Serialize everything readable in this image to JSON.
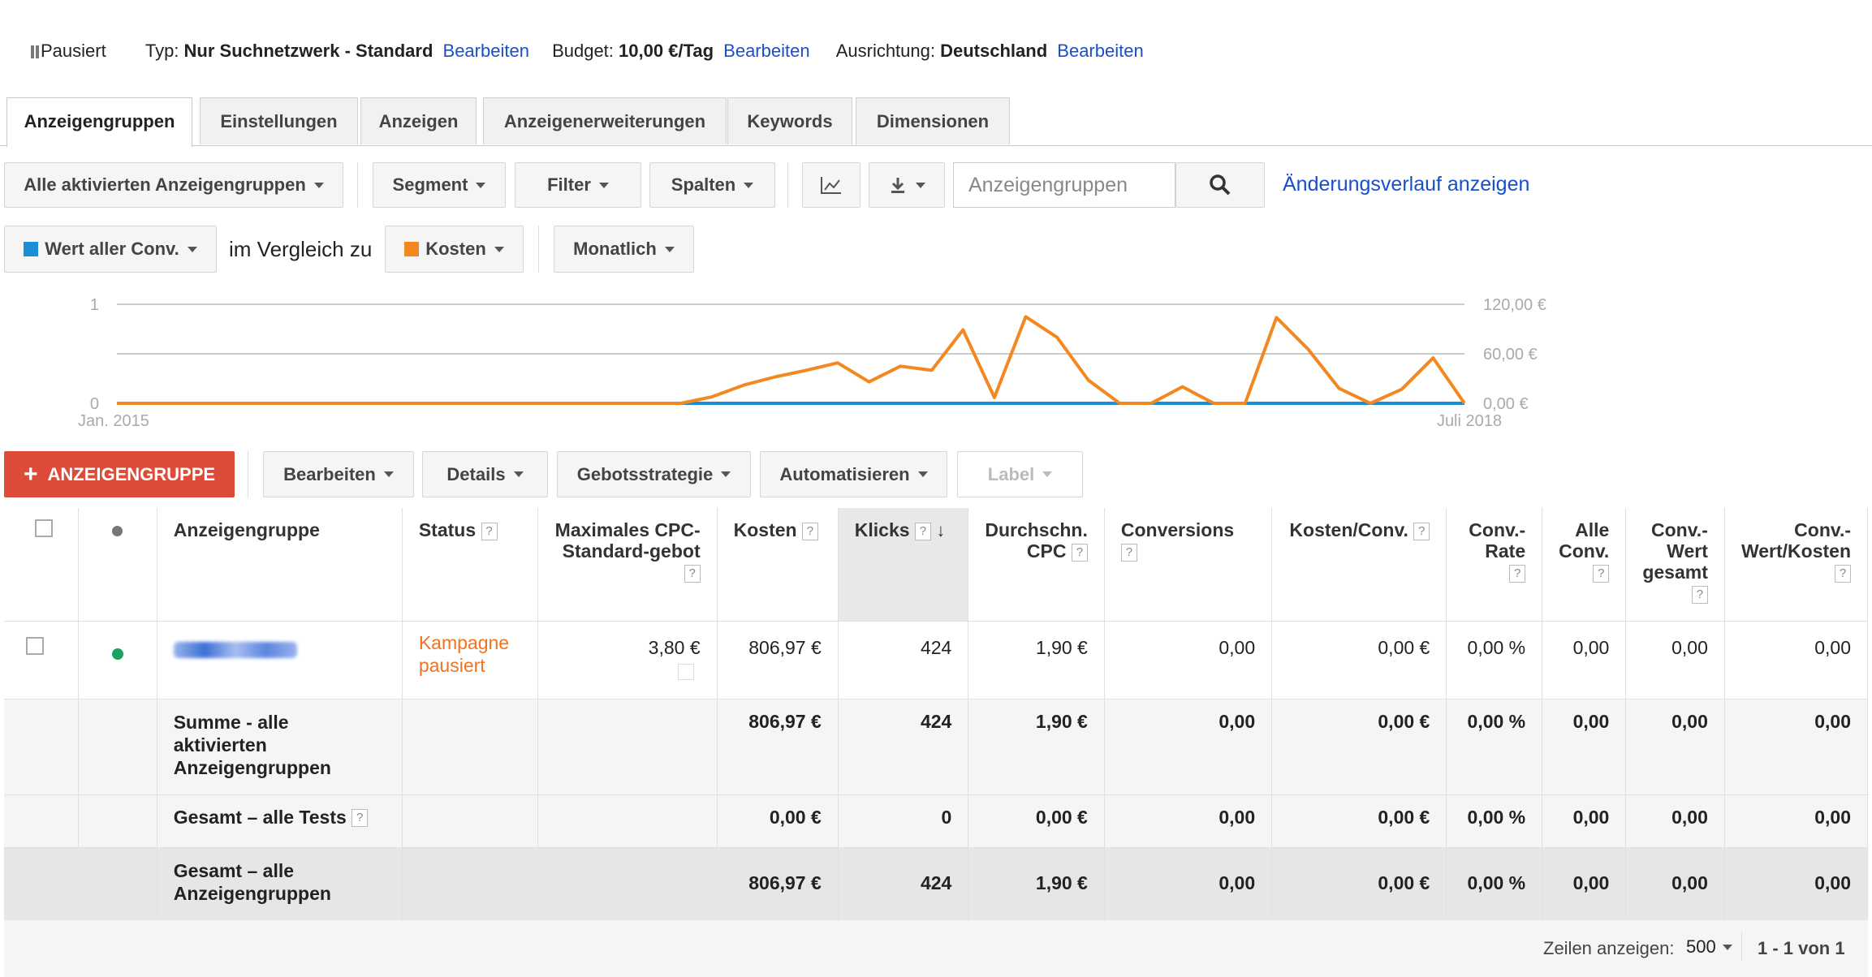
{
  "status": {
    "state": "Pausiert",
    "type_label": "Typ:",
    "type_value": "Nur Suchnetzwerk - Standard",
    "edit1": "Bearbeiten",
    "budget_label": "Budget:",
    "budget_value": "10,00 €/Tag",
    "edit2": "Bearbeiten",
    "targeting_label": "Ausrichtung:",
    "targeting_value": "Deutschland",
    "edit3": "Bearbeiten"
  },
  "tabs": [
    "Anzeigengruppen",
    "Einstellungen",
    "Anzeigen",
    "Anzeigenerweiterungen",
    "Keywords",
    "Dimensionen"
  ],
  "toolbar": {
    "filter_all": "Alle aktivierten Anzeigengruppen",
    "segment": "Segment",
    "filter": "Filter",
    "columns": "Spalten",
    "search_placeholder": "Anzeigengruppen",
    "history_link": "Änderungsverlauf anzeigen"
  },
  "chart_controls": {
    "metric1": "Wert aller Conv.",
    "compare_text": "im Vergleich zu",
    "metric2": "Kosten",
    "period": "Monatlich"
  },
  "colors": {
    "blue_series": "#1a8fd8",
    "orange_series": "#f2881f",
    "red_button": "#dd4b39",
    "link": "#1a4fc7",
    "status_orange": "#f2731f",
    "active_dot": "#1aa260"
  },
  "chart_data": {
    "type": "line",
    "x_start_label": "Jan. 2015",
    "x_end_label": "Juli 2018",
    "left_axis_ticks": [
      "0",
      "1"
    ],
    "right_axis_ticks": [
      "0,00 €",
      "60,00 €",
      "120,00 €"
    ],
    "left_ylim": [
      0,
      1
    ],
    "right_ylim": [
      0,
      120
    ],
    "grid": true,
    "series": [
      {
        "name": "Wert aller Conv.",
        "axis": "left",
        "values": [
          0,
          0,
          0,
          0,
          0,
          0,
          0,
          0,
          0,
          0,
          0,
          0,
          0,
          0,
          0,
          0,
          0,
          0,
          0,
          0,
          0,
          0,
          0,
          0,
          0,
          0,
          0,
          0,
          0,
          0,
          0,
          0,
          0,
          0,
          0,
          0,
          0,
          0,
          0,
          0,
          0,
          0,
          0
        ]
      },
      {
        "name": "Kosten",
        "axis": "right",
        "values": [
          0,
          0,
          0,
          0,
          0,
          0,
          0,
          0,
          0,
          0,
          0,
          0,
          0,
          0,
          0,
          0,
          0,
          0,
          0,
          8,
          22,
          32,
          40,
          49,
          26,
          45,
          40,
          89,
          7,
          105,
          80,
          28,
          0,
          0,
          20,
          0,
          0,
          104,
          66,
          18,
          0,
          17,
          55,
          0
        ]
      }
    ]
  },
  "actions": {
    "add_group": "ANZEIGENGRUPPE",
    "edit": "Bearbeiten",
    "details": "Details",
    "bid_strategy": "Gebotsstrategie",
    "automate": "Automatisieren",
    "label": "Label"
  },
  "table": {
    "headers": {
      "group": "Anzeigengruppe",
      "status": "Status",
      "max_cpc": "Maximales CPC-Standard-gebot",
      "cost": "Kosten",
      "clicks": "Klicks",
      "avg_cpc": "Durchschn. CPC",
      "conversions": "Conversions",
      "cost_conv": "Kosten/Conv.",
      "conv_rate": "Conv.-Rate",
      "all_conv": "Alle Conv.",
      "conv_value": "Conv.-Wert gesamt",
      "conv_value_cost": "Conv.-Wert/Kosten"
    },
    "row": {
      "status": "Kampagne pausiert",
      "max_cpc": "3,80 €",
      "cost": "806,97 €",
      "clicks": "424",
      "avg_cpc": "1,90 €",
      "conversions": "0,00",
      "cost_conv": "0,00 €",
      "conv_rate": "0,00 %",
      "all_conv": "0,00",
      "conv_value": "0,00",
      "conv_value_cost": "0,00"
    },
    "sum_active": {
      "label": "Summe - alle aktivierten Anzeigengruppen",
      "cost": "806,97 €",
      "clicks": "424",
      "avg_cpc": "1,90 €",
      "conversions": "0,00",
      "cost_conv": "0,00 €",
      "conv_rate": "0,00 %",
      "all_conv": "0,00",
      "conv_value": "0,00",
      "conv_value_cost": "0,00"
    },
    "total_tests": {
      "label": "Gesamt – alle Tests",
      "cost": "0,00 €",
      "clicks": "0",
      "avg_cpc": "0,00 €",
      "conversions": "0,00",
      "cost_conv": "0,00 €",
      "conv_rate": "0,00 %",
      "all_conv": "0,00",
      "conv_value": "0,00",
      "conv_value_cost": "0,00"
    },
    "total_all": {
      "label": "Gesamt – alle Anzeigengruppen",
      "cost": "806,97 €",
      "clicks": "424",
      "avg_cpc": "1,90 €",
      "conversions": "0,00",
      "cost_conv": "0,00 €",
      "conv_rate": "0,00 %",
      "all_conv": "0,00",
      "conv_value": "0,00",
      "conv_value_cost": "0,00"
    }
  },
  "footer": {
    "rows_label": "Zeilen anzeigen:",
    "rows_value": "500",
    "range": "1 - 1 von 1"
  }
}
